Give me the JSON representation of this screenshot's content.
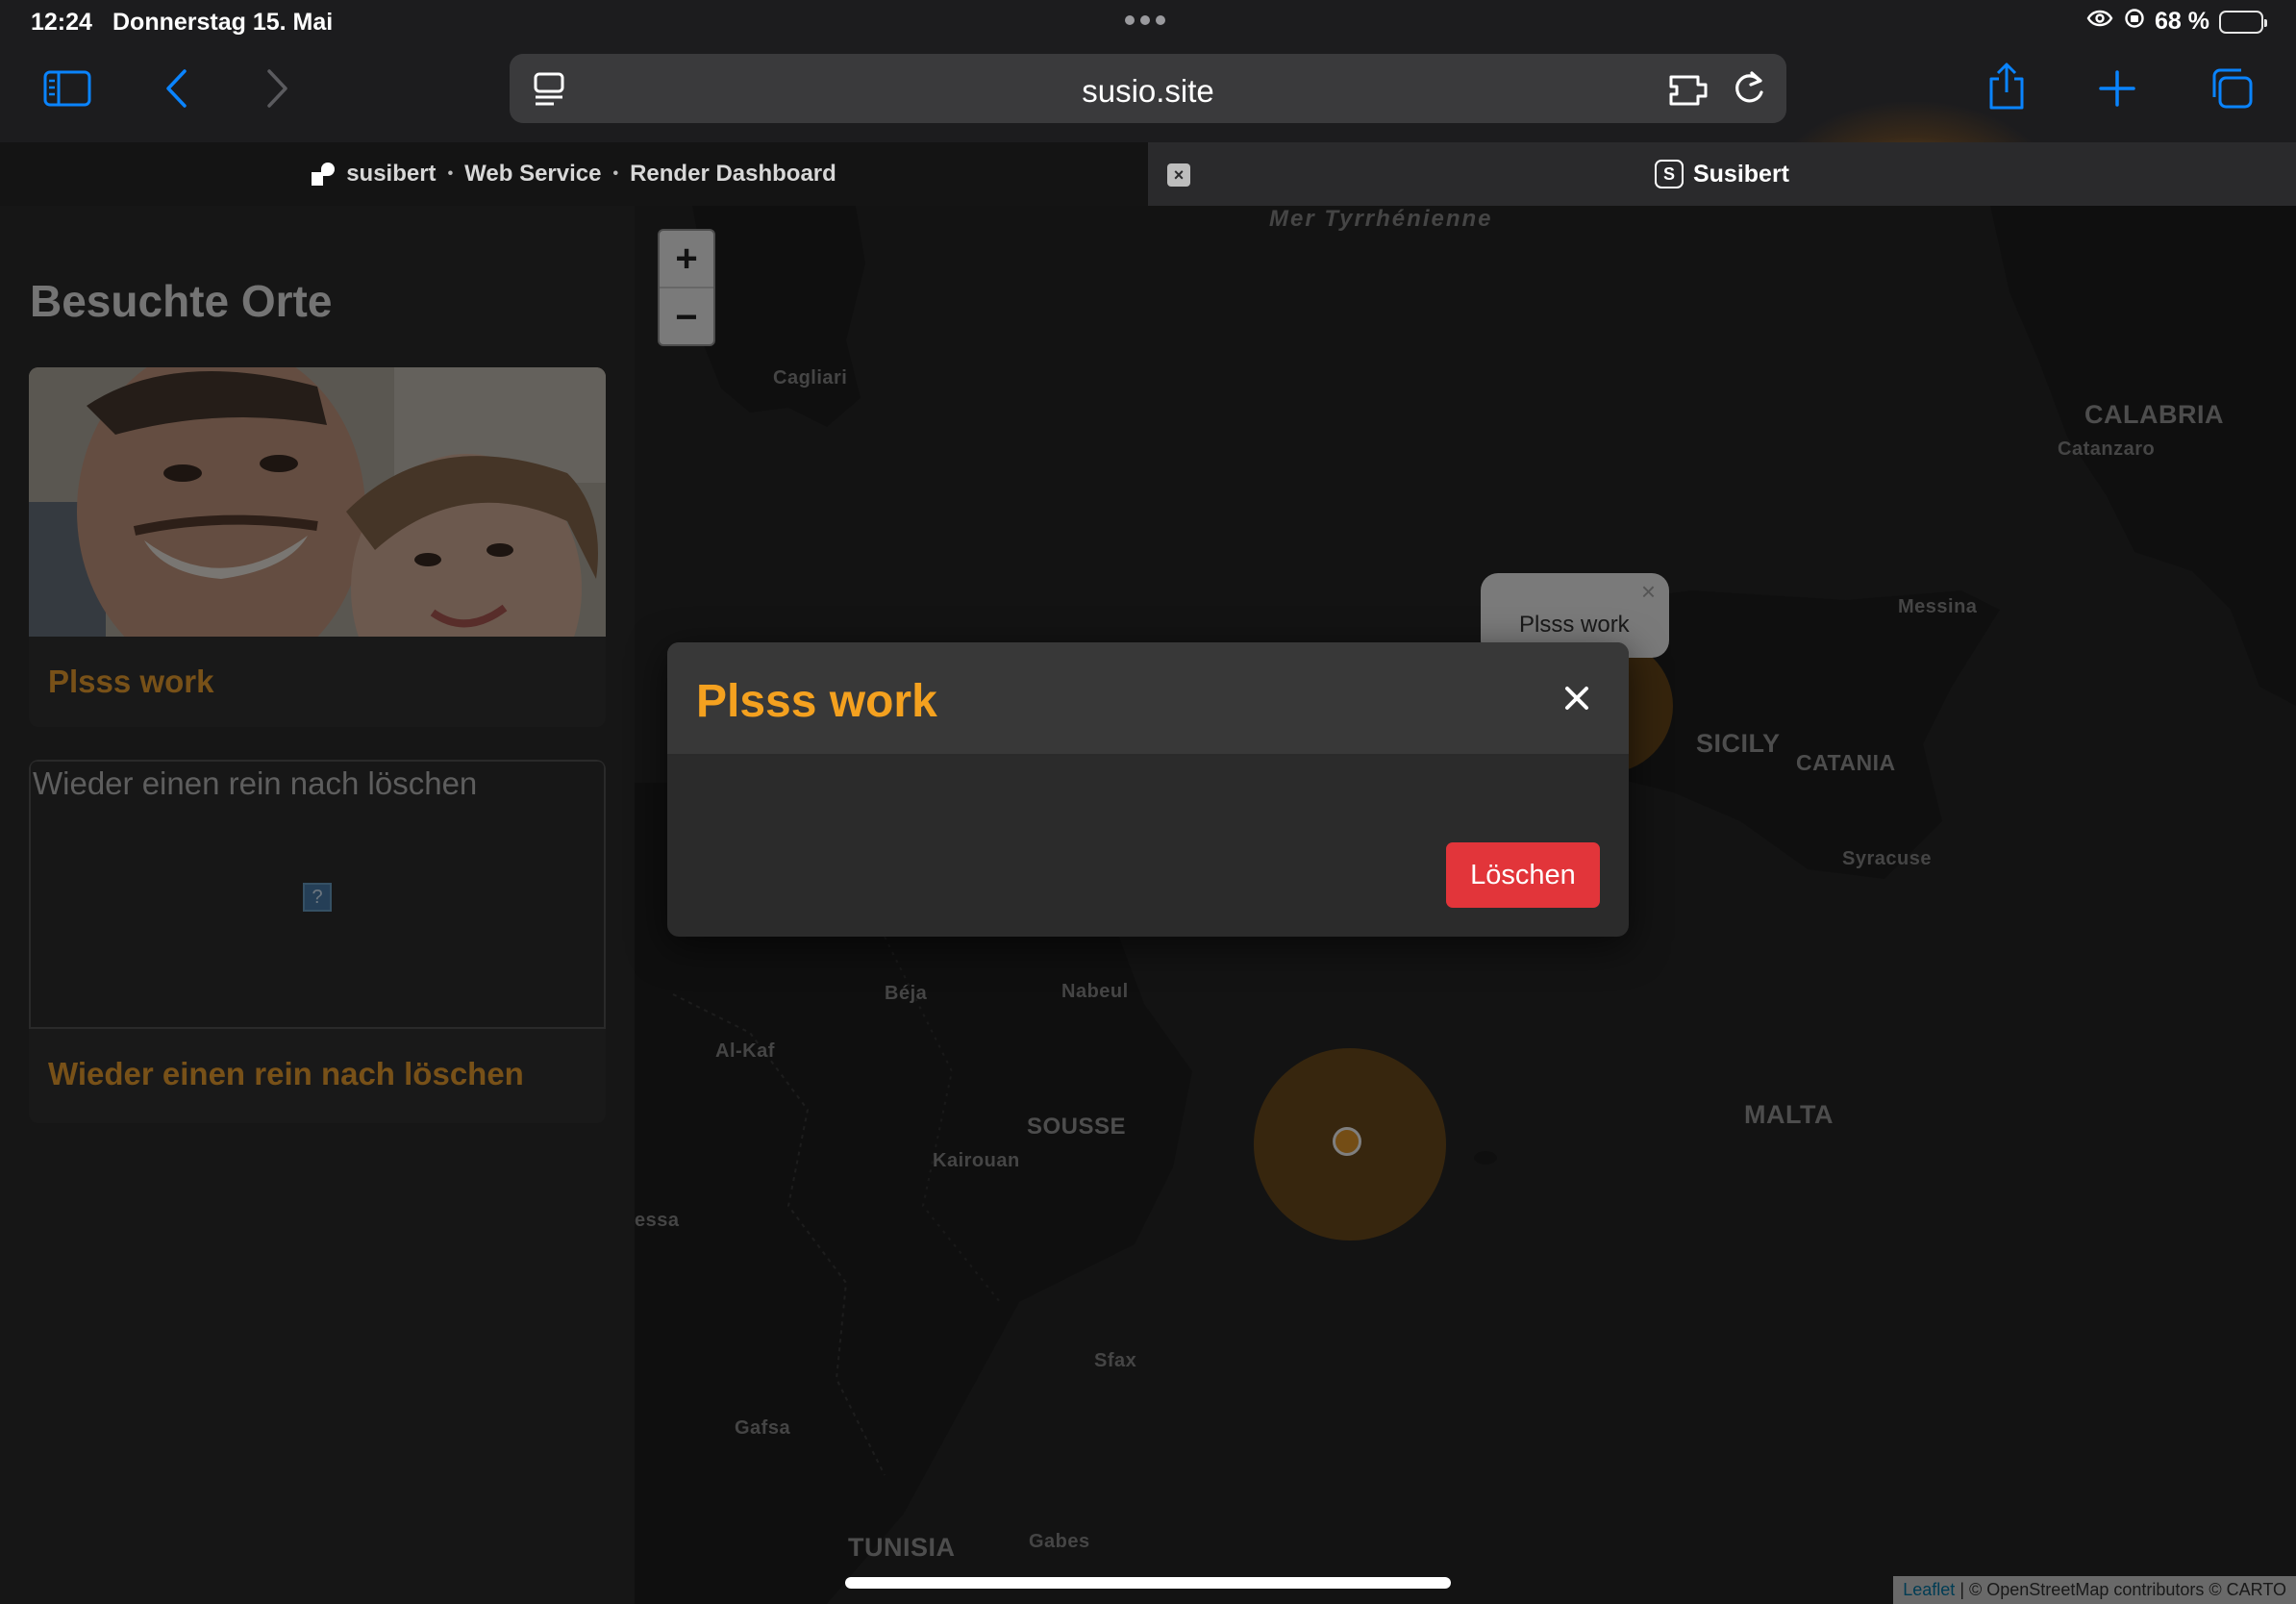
{
  "status_bar": {
    "time": "12:24",
    "date": "Donnerstag 15. Mai",
    "battery": "68 %",
    "battery_level": 0.68
  },
  "toolbar": {
    "url": "susio.site"
  },
  "tabs": {
    "left_parts": [
      "susibert",
      "Web Service",
      "Render Dashboard"
    ],
    "right_badge": "S",
    "right_label": "Susibert"
  },
  "sidebar": {
    "title": "Besuchte Orte",
    "cards": [
      {
        "title": "Plsss work"
      },
      {
        "title": "Wieder einen rein nach löschen",
        "image_alt": "Wieder einen rein nach löschen"
      }
    ]
  },
  "map": {
    "zoom_in": "+",
    "zoom_out": "−",
    "labels": {
      "sea": "Mer Tyrrhénienne",
      "cagliari": "Cagliari",
      "calabria": "CALABRIA",
      "catanzaro": "Catanzaro",
      "messina": "Messina",
      "sicily": "SICILY",
      "catania": "CATANIA",
      "syracuse": "Syracuse",
      "malta": "MALTA",
      "nabeul": "Nabeul",
      "al_kaf": "Al-Kaf",
      "sousse": "SOUSSE",
      "kairouan": "Kairouan",
      "sfax": "Sfax",
      "gafsa": "Gafsa",
      "tunisia": "TUNISIA",
      "gabes": "Gabes",
      "essa": "essa",
      "beja": "Béja"
    },
    "tooltip": "Plsss work",
    "attribution_leaflet": "Leaflet",
    "attribution_rest": "| © OpenStreetMap contributors © CARTO"
  },
  "modal": {
    "title": "Plsss work",
    "delete_label": "Löschen"
  },
  "colors": {
    "accent": "#f4a11f",
    "danger": "#e2353a",
    "ios_blue": "#0a84ff"
  }
}
